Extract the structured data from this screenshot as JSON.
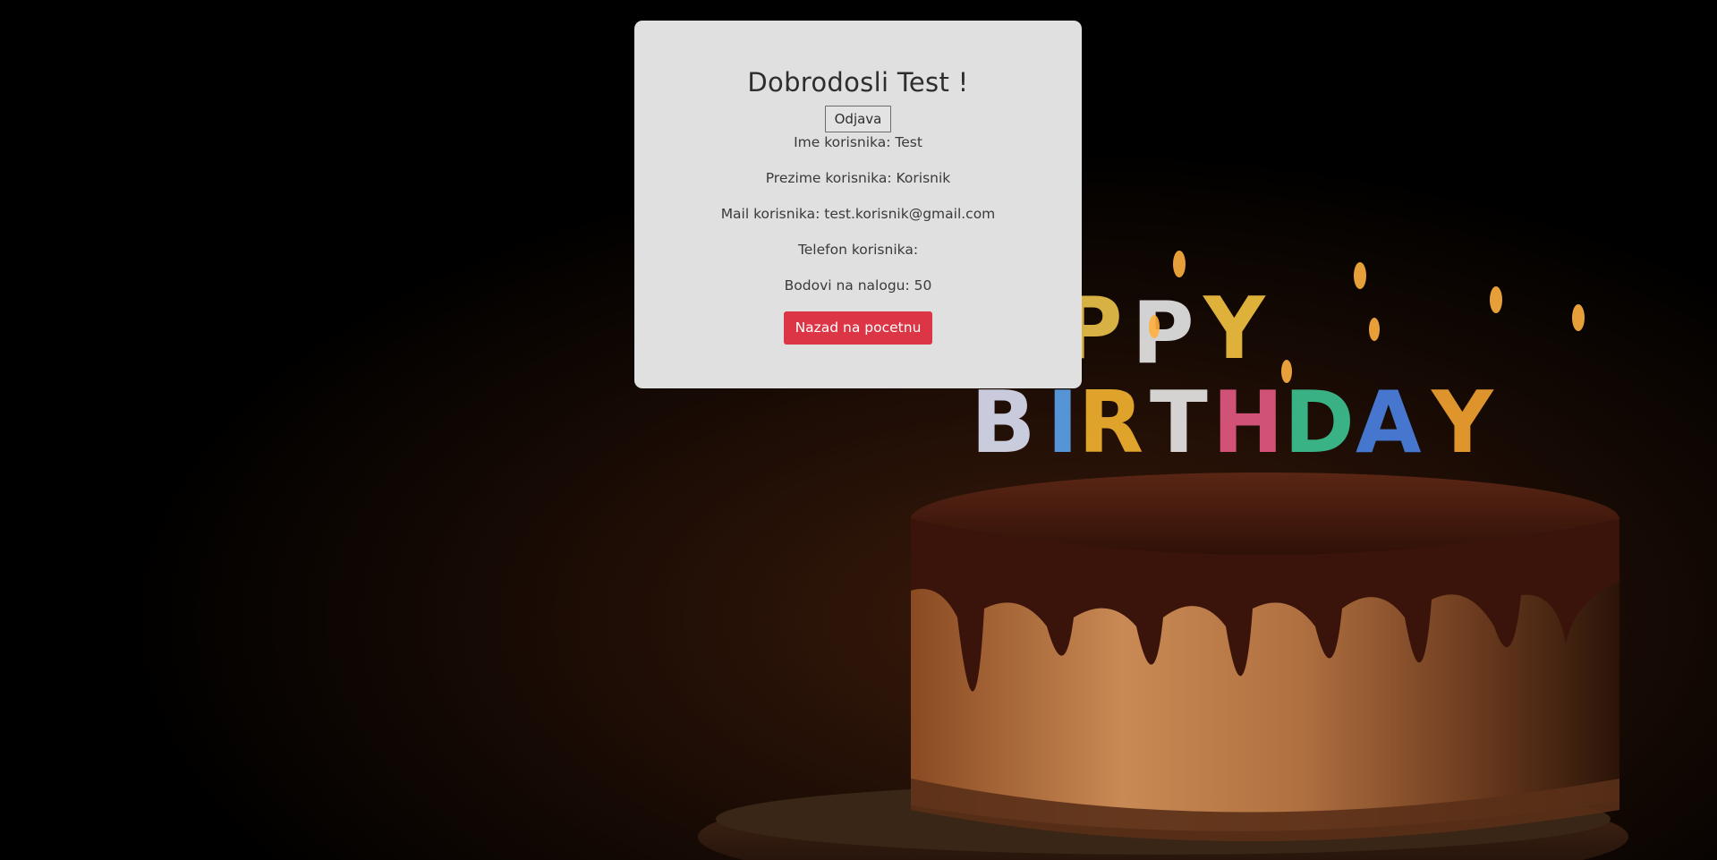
{
  "background": {
    "description_icon": "birthday-cake-image",
    "candles": [
      "H",
      "A",
      "P",
      "P",
      "Y",
      "B",
      "I",
      "R",
      "T",
      "H",
      "D",
      "A",
      "Y"
    ]
  },
  "profile": {
    "title": "Dobrodosli Test !",
    "logout_label": "Odjava",
    "first_name": "Ime korisnika: Test",
    "last_name": "Prezime korisnika: Korisnik",
    "email": "Mail korisnika: test.korisnik@gmail.com",
    "phone": "Telefon korisnika:",
    "points": "Bodovi na nalogu: 50",
    "home_label": "Nazad na pocetnu"
  },
  "colors": {
    "card_bg": "#e0e0e0",
    "primary_button": "#dc3545",
    "page_bg": "#000000"
  }
}
